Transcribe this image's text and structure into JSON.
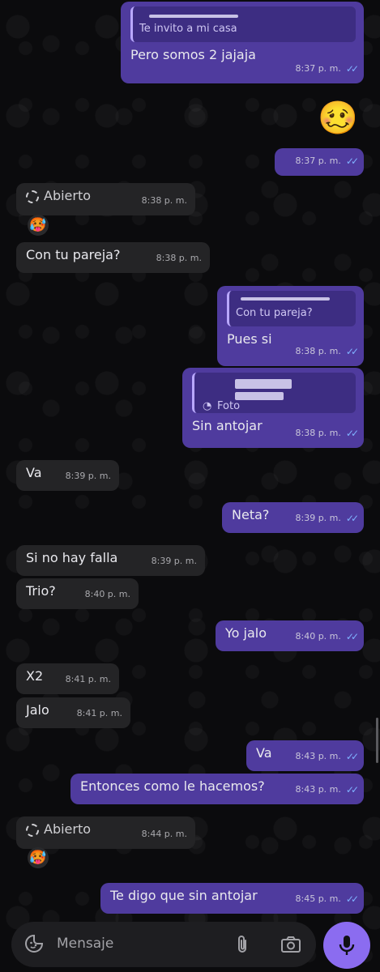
{
  "messages": [
    {
      "type": "out_quote",
      "quote": "Te invito a mi casa",
      "text": "Pero somos 2 jajaja",
      "time": "8:37 p. m."
    },
    {
      "type": "out_emoji",
      "emoji": "🥴",
      "time": "8:37 p. m."
    },
    {
      "type": "in_status",
      "status": "Abierto",
      "time": "8:38 p. m.",
      "reaction": "🥵"
    },
    {
      "type": "in",
      "text": "Con tu pareja?",
      "time": "8:38 p. m."
    },
    {
      "type": "out_quote",
      "quote": "Con tu pareja?",
      "text": "Pues si",
      "time": "8:38 p. m."
    },
    {
      "type": "out_quote",
      "quote": "Foto",
      "text": "Sin antojar",
      "time": "8:38 p. m."
    },
    {
      "type": "in",
      "text": "Va",
      "time": "8:39 p. m."
    },
    {
      "type": "out",
      "text": "Neta?",
      "time": "8:39 p. m."
    },
    {
      "type": "in",
      "text": "Si no hay falla",
      "time": "8:39 p. m."
    },
    {
      "type": "in",
      "text": "Trio?",
      "time": "8:40 p. m."
    },
    {
      "type": "out",
      "text": "Yo jalo",
      "time": "8:40 p. m."
    },
    {
      "type": "in",
      "text": "X2",
      "time": "8:41 p. m."
    },
    {
      "type": "in",
      "text": "Jalo",
      "time": "8:41 p. m."
    },
    {
      "type": "out",
      "text": "Va",
      "time": "8:43 p. m."
    },
    {
      "type": "out",
      "text": "Entonces como le hacemos?",
      "time": "8:43 p. m."
    },
    {
      "type": "in_status",
      "status": "Abierto",
      "time": "8:44 p. m.",
      "reaction": "🥵"
    },
    {
      "type": "out",
      "text": "Te digo que sin antojar",
      "time": "8:45 p. m."
    }
  ],
  "input": {
    "placeholder": "Mensaje"
  },
  "icons": {
    "emoji": "sticker-icon",
    "attach": "paperclip-icon",
    "camera": "camera-icon",
    "mic": "microphone-icon",
    "read": "double-check-icon"
  },
  "colors": {
    "outgoing": "#4f3b9e",
    "incoming": "#242426",
    "accent": "#8b6cf0",
    "read_ticks": "#7fb2ff"
  }
}
